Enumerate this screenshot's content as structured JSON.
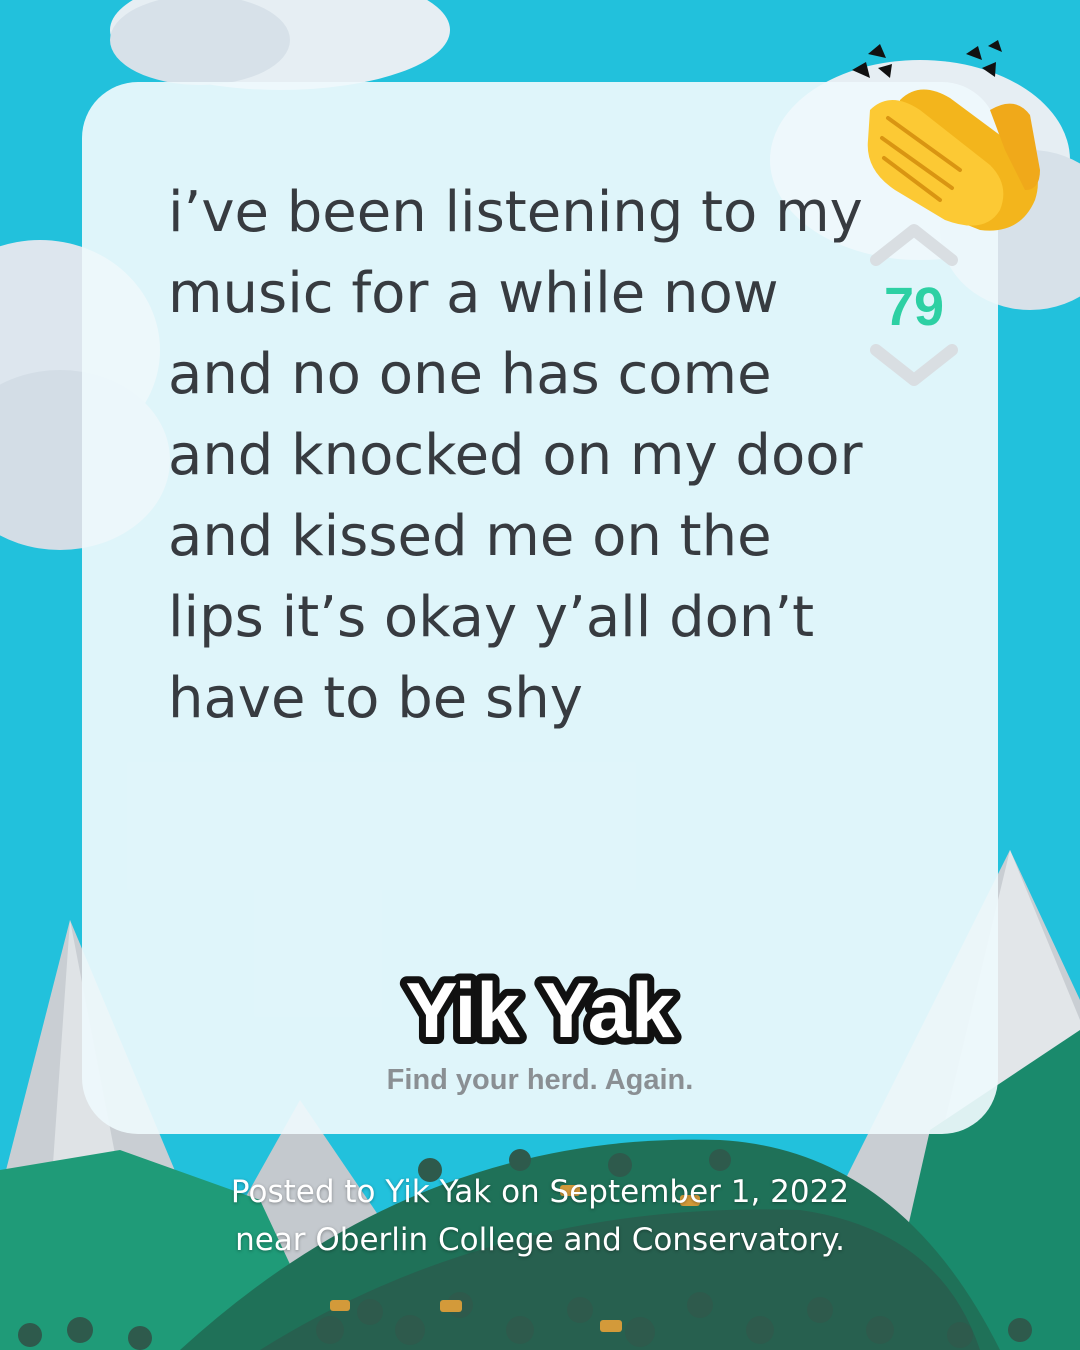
{
  "post": {
    "text": "i’ve been listening to my\nmusic for a while now\nand no one has come\nand knocked on my door\nand kissed me on the\nlips it’s okay y’all don’t\nhave to be shy"
  },
  "vote": {
    "count": "79",
    "upvote_icon": "chevron-up-icon",
    "downvote_icon": "chevron-down-icon"
  },
  "brand": {
    "logo_text": "Yik Yak",
    "tagline": "Find your herd. Again."
  },
  "caption": "Posted to Yik Yak on September 1, 2022 near Oberlin College and Conservatory.",
  "decor": {
    "emoji": "clapping-hands-icon"
  },
  "colors": {
    "sky": "#22c1dc",
    "vote_accent": "#2dd0a3",
    "text": "#373b40",
    "tagline": "#8a8f93"
  }
}
